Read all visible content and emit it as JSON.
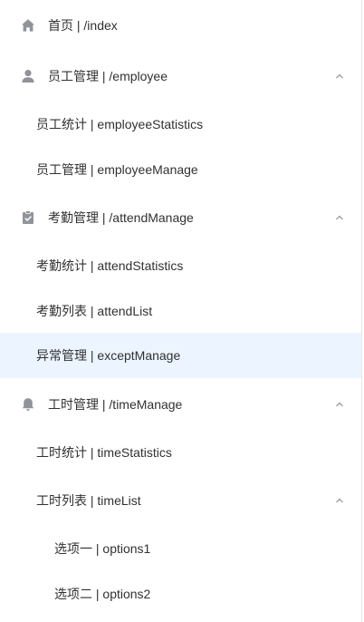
{
  "menu": {
    "items": [
      {
        "label": "首页 | /index",
        "icon": "home-icon"
      },
      {
        "label": "员工管理 | /employee",
        "icon": "user-icon",
        "expanded": true
      },
      {
        "label": "员工统计 | employeeStatistics"
      },
      {
        "label": "员工管理 | employeeManage"
      },
      {
        "label": "考勤管理 | /attendManage",
        "icon": "clipboard-check-icon",
        "expanded": true
      },
      {
        "label": "考勤统计 | attendStatistics"
      },
      {
        "label": "考勤列表 | attendList"
      },
      {
        "label": "异常管理 | exceptManage",
        "active": true
      },
      {
        "label": "工时管理 | /timeManage",
        "icon": "bell-icon",
        "expanded": true
      },
      {
        "label": "工时统计 | timeStatistics"
      },
      {
        "label": "工时列表 | timeList",
        "expanded": true
      },
      {
        "label": "选项一 | options1"
      },
      {
        "label": "选项二 | options2"
      }
    ]
  },
  "colors": {
    "text": "#303133",
    "icon": "#909399",
    "active_bg": "#ecf5ff",
    "border": "#e6e6e6"
  }
}
